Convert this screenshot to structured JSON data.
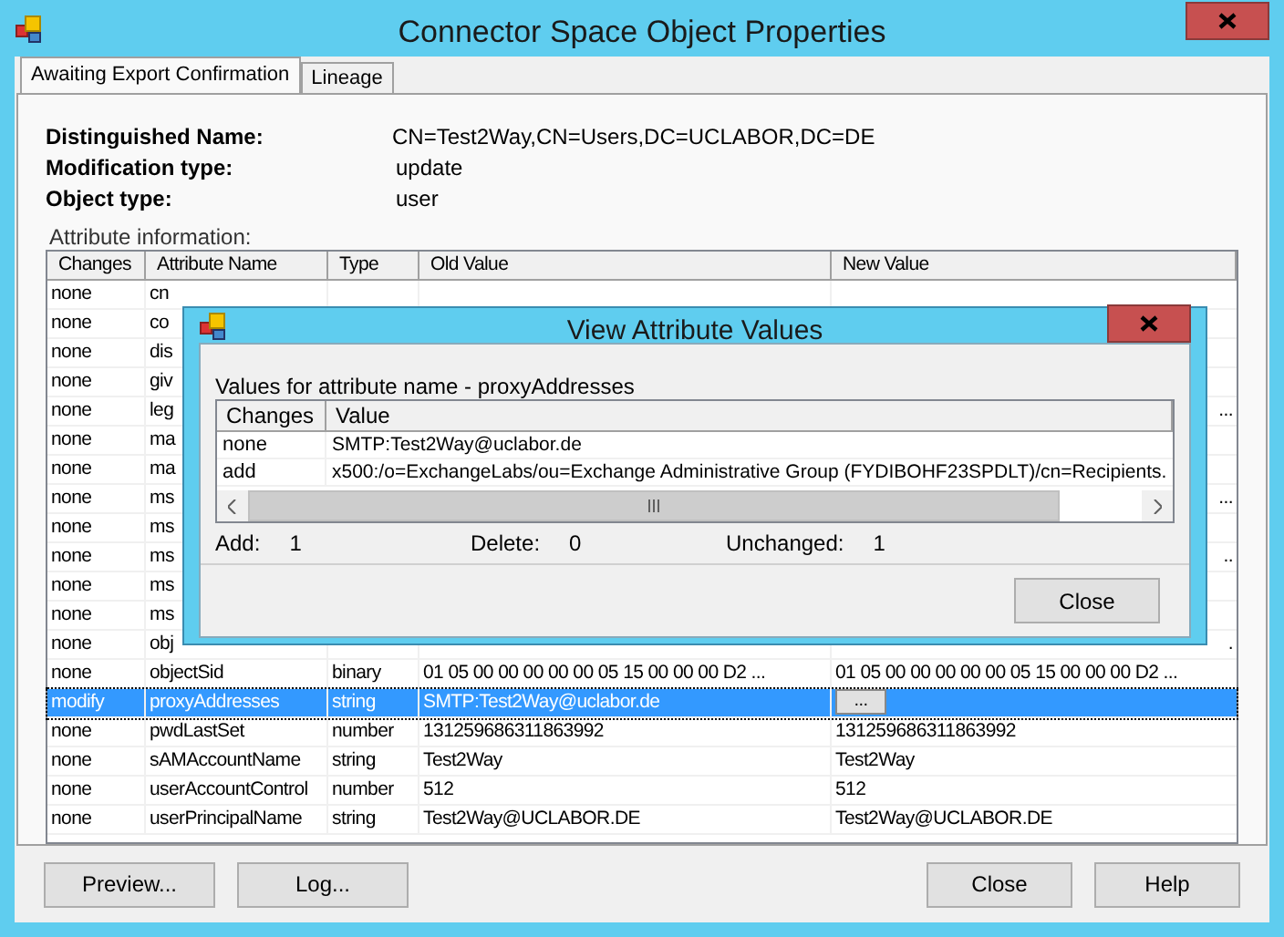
{
  "window": {
    "title": "Connector Space Object Properties"
  },
  "tabs": [
    {
      "label": "Awaiting Export Confirmation",
      "selected": true
    },
    {
      "label": "Lineage",
      "selected": false
    }
  ],
  "details": [
    {
      "label": "Distinguished Name:",
      "value": "CN=Test2Way,CN=Users,DC=UCLABOR,DC=DE"
    },
    {
      "label": "Modification type:",
      "value": "update"
    },
    {
      "label": "Object type:",
      "value": "user"
    }
  ],
  "attribute_info_label": "Attribute information:",
  "table": {
    "columns": [
      "Changes",
      "Attribute Name",
      "Type",
      "Old Value",
      "New Value"
    ],
    "rows": [
      {
        "changes": "none",
        "name": "cn",
        "type": "",
        "old": "",
        "new": "",
        "selected": false
      },
      {
        "changes": "none",
        "name": "co",
        "type": "",
        "old": "",
        "new": "",
        "selected": false
      },
      {
        "changes": "none",
        "name": "dis",
        "type": "",
        "old": "",
        "new": "",
        "selected": false
      },
      {
        "changes": "none",
        "name": "giv",
        "type": "",
        "old": "",
        "new": "",
        "selected": false
      },
      {
        "changes": "none",
        "name": "leg",
        "type": "",
        "old": "",
        "new": "...",
        "selected": false
      },
      {
        "changes": "none",
        "name": "ma",
        "type": "",
        "old": "",
        "new": "",
        "selected": false
      },
      {
        "changes": "none",
        "name": "ma",
        "type": "",
        "old": "",
        "new": "",
        "selected": false
      },
      {
        "changes": "none",
        "name": "ms",
        "type": "",
        "old": "",
        "new": "...",
        "selected": false
      },
      {
        "changes": "none",
        "name": "ms",
        "type": "",
        "old": "",
        "new": "",
        "selected": false
      },
      {
        "changes": "none",
        "name": "ms",
        "type": "",
        "old": "",
        "new": "..",
        "selected": false
      },
      {
        "changes": "none",
        "name": "ms",
        "type": "",
        "old": "",
        "new": "",
        "selected": false
      },
      {
        "changes": "none",
        "name": "ms",
        "type": "",
        "old": "",
        "new": "",
        "selected": false
      },
      {
        "changes": "none",
        "name": "obj",
        "type": "",
        "old": "",
        "new": ".",
        "selected": false
      },
      {
        "changes": "none",
        "name": "objectSid",
        "type": "binary",
        "old": "01 05 00 00 00 00 00 05 15 00 00 00 D2 ...",
        "new": "01 05 00 00 00 00 00 05 15 00 00 00 D2 ...",
        "selected": false
      },
      {
        "changes": "modify",
        "name": "proxyAddresses",
        "type": "string",
        "old": "SMTP:Test2Way@uclabor.de",
        "new_button": "...",
        "selected": true
      },
      {
        "changes": "none",
        "name": "pwdLastSet",
        "type": "number",
        "old": "131259686311863992",
        "new": "131259686311863992",
        "selected": false
      },
      {
        "changes": "none",
        "name": "sAMAccountName",
        "type": "string",
        "old": "Test2Way",
        "new": "Test2Way",
        "selected": false
      },
      {
        "changes": "none",
        "name": "userAccountControl",
        "type": "number",
        "old": "512",
        "new": "512",
        "selected": false
      },
      {
        "changes": "none",
        "name": "userPrincipalName",
        "type": "string",
        "old": "Test2Way@UCLABOR.DE",
        "new": "Test2Way@UCLABOR.DE",
        "selected": false
      }
    ]
  },
  "buttons_left": [
    "Preview...",
    "Log..."
  ],
  "buttons_right": [
    "Close",
    "Help"
  ],
  "dialog": {
    "title": "View Attribute Values",
    "label": "Values for attribute name - proxyAddresses",
    "columns": [
      "Changes",
      "Value"
    ],
    "rows": [
      {
        "changes": "none",
        "value": "SMTP:Test2Way@uclabor.de"
      },
      {
        "changes": "add",
        "value": "x500:/o=ExchangeLabs/ou=Exchange Administrative Group (FYDIBOHF23SPDLT)/cn=Recipients."
      }
    ],
    "counts": [
      {
        "label": "Add:",
        "value": "1"
      },
      {
        "label": "Delete:",
        "value": "0"
      },
      {
        "label": "Unchanged:",
        "value": "1"
      }
    ],
    "button": "Close"
  }
}
